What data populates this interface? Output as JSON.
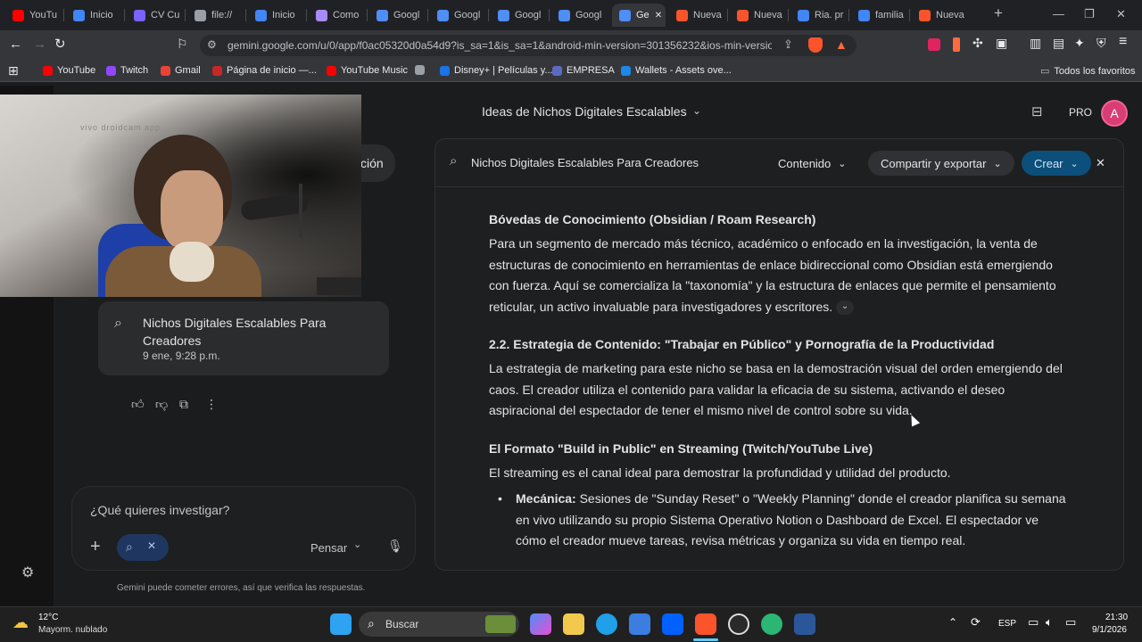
{
  "tabs": [
    {
      "label": "YouTu",
      "color": "#ff0000"
    },
    {
      "label": "Inicio",
      "color": "#4285f4"
    },
    {
      "label": "CV Cu",
      "color": "#7b61ff"
    },
    {
      "label": "file://",
      "color": "#9aa0a6"
    },
    {
      "label": "Inicio",
      "color": "#4285f4"
    },
    {
      "label": "Como",
      "color": "#a78bfa"
    },
    {
      "label": "Googl",
      "color": "#4f8df7"
    },
    {
      "label": "Googl",
      "color": "#4f8df7"
    },
    {
      "label": "Googl",
      "color": "#4f8df7"
    },
    {
      "label": "Googl",
      "color": "#4f8df7"
    },
    {
      "label": "Ge",
      "color": "#4f8df7",
      "active": true
    },
    {
      "label": "Nueva",
      "color": "#fb542b"
    },
    {
      "label": "Nueva",
      "color": "#fb542b"
    },
    {
      "label": "Ria. pr",
      "color": "#4285f4"
    },
    {
      "label": "familia",
      "color": "#4285f4"
    },
    {
      "label": "Nueva",
      "color": "#fb542b"
    }
  ],
  "address_url": "gemini.google.com/u/0/app/f0ac05320d0a54d9?is_sa=1&is_sa=1&android-min-version=301356232&ios-min-versio...",
  "bookmarks": [
    {
      "label": "YouTube",
      "color": "#ff0000"
    },
    {
      "label": "Twitch",
      "color": "#9146ff"
    },
    {
      "label": "Gmail",
      "color": "#ea4335"
    },
    {
      "label": "Página de inicio —...",
      "color": "#c62828"
    },
    {
      "label": "YouTube Music",
      "color": "#ff0000"
    },
    {
      "label": "",
      "color": "#9aa0a6"
    },
    {
      "label": "Disney+ | Películas y...",
      "color": "#1a73e8"
    },
    {
      "label": "EMPRESA",
      "color": "#5c6bc0"
    },
    {
      "label": "Wallets - Assets ove...",
      "color": "#1e88e5"
    }
  ],
  "all_favorites": "Todos los favoritos",
  "webcam_watermark": "vivo droidcam app",
  "left_partial": "ción",
  "conversation_title": "Ideas de Nichos Digitales Escalables",
  "pro_label": "PRO",
  "avatar_letter": "A",
  "research_chip": {
    "title": "Nichos Digitales Escalables Para Creadores",
    "date": "9 ene, 9:28 p.m."
  },
  "input_placeholder": "¿Qué quieres investigar?",
  "think_label": "Pensar",
  "disclaimer": "Gemini puede cometer errores, así que verifica las respuestas.",
  "panel": {
    "title": "Nichos Digitales Escalables Para Creadores",
    "content_btn": "Contenido",
    "share_btn": "Compartir y exportar",
    "create_btn": "Crear"
  },
  "doc": {
    "h1": "Bóvedas de Conocimiento (Obsidian / Roam Research)",
    "p1": "Para un segmento de mercado más técnico, académico o enfocado en la investigación, la venta de estructuras de conocimiento en herramientas de enlace bidireccional como Obsidian está emergiendo con fuerza. Aquí se comercializa la \"taxonomía\" y la estructura de enlaces que permite el pensamiento reticular, un activo invaluable para investigadores y escritores.",
    "h2": "2.2. Estrategia de Contenido: \"Trabajar en Público\" y Pornografía de la Productividad",
    "p2": "La estrategia de marketing para este nicho se basa en la demostración visual del orden emergiendo del caos. El creador utiliza el contenido para validar la eficacia de su sistema, activando el deseo aspiracional del espectador de tener el mismo nivel de control sobre su vida.",
    "h3": "El Formato \"Build in Public\" en Streaming (Twitch/YouTube Live)",
    "p3": "El streaming es el canal ideal para demostrar la profundidad y utilidad del producto.",
    "li_label": "Mecánica:",
    "li_text": " Sesiones de \"Sunday Reset\" o \"Weekly Planning\" donde el creador planifica su semana en vivo utilizando su propio Sistema Operativo Notion o Dashboard de Excel. El espectador ve cómo el creador mueve tareas, revisa métricas y organiza su vida en tiempo real."
  },
  "weather": {
    "temp": "12°C",
    "desc": "Mayorm. nublado"
  },
  "search_label": "Buscar",
  "lang": "ESP",
  "clock": {
    "time": "21:30",
    "date": "9/1/2026"
  }
}
